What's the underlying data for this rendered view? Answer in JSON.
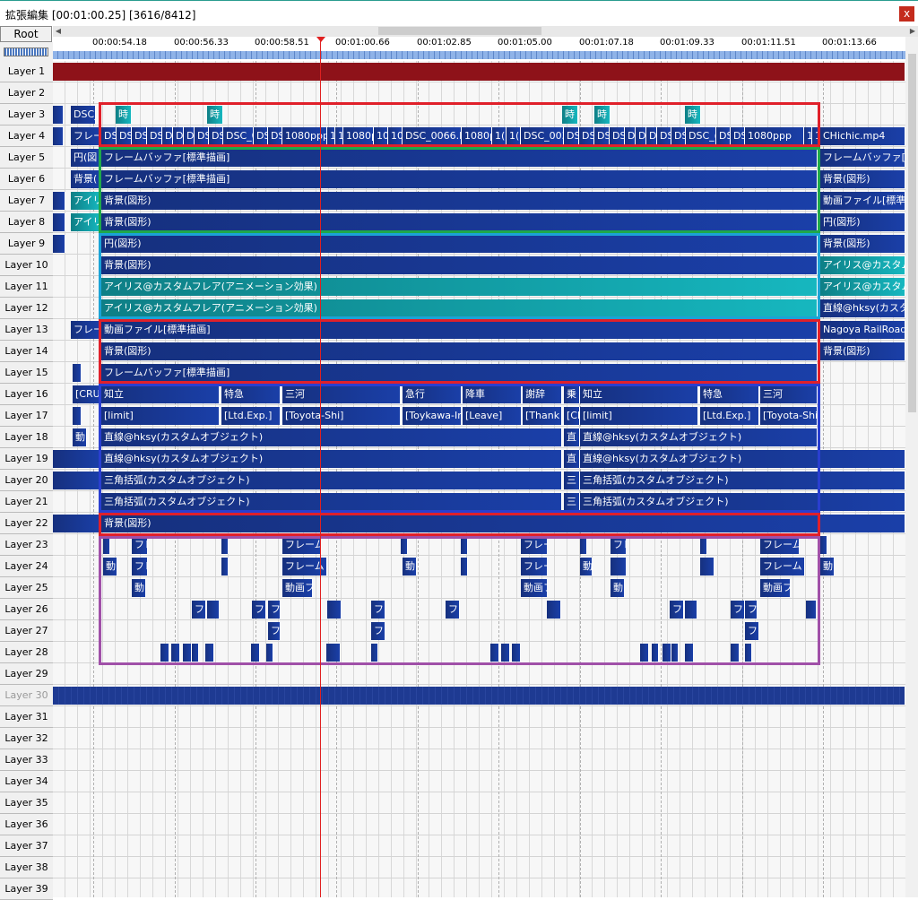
{
  "window": {
    "title": "拡張編集 [00:01:00.25] [3616/8412]",
    "close_label": "x"
  },
  "root_button": "Root",
  "ruler": {
    "ticks": [
      "00:00:54.18",
      "00:00:56.33",
      "00:00:58.51",
      "00:01:00.66",
      "00:01:02.85",
      "00:01:05.00",
      "00:01:07.18",
      "00:01:09.33",
      "00:01:11.51",
      "00:01:13.66"
    ]
  },
  "layers": [
    "Layer 1",
    "Layer 2",
    "Layer 3",
    "Layer 4",
    "Layer 5",
    "Layer 6",
    "Layer 7",
    "Layer 8",
    "Layer 9",
    "Layer 10",
    "Layer 11",
    "Layer 12",
    "Layer 13",
    "Layer 14",
    "Layer 15",
    "Layer 16",
    "Layer 17",
    "Layer 18",
    "Layer 19",
    "Layer 20",
    "Layer 21",
    "Layer 22",
    "Layer 23",
    "Layer 24",
    "Layer 25",
    "Layer 26",
    "Layer 27",
    "Layer 28",
    "Layer 29",
    "Layer 30",
    "Layer 31",
    "Layer 32",
    "Layer 33",
    "Layer 34",
    "Layer 35",
    "Layer 36",
    "Layer 37",
    "Layer 38",
    "Layer 39"
  ],
  "colors": {
    "clip_blue": "#1a3fa8",
    "clip_teal": "#16b7bf",
    "clip_maroon": "#8e1219",
    "cursor": "#e02020",
    "highlight_red": "#e0202a",
    "highlight_green": "#1fa84a",
    "highlight_cyan": "#1ba3d6",
    "highlight_blue": "#2a3fd0",
    "highlight_purple": "#a050a8"
  },
  "clips": {
    "l3": [
      "DSC_(",
      "時",
      "時",
      "時",
      "時",
      "時"
    ],
    "l4": [
      "フレー",
      "DS",
      "DS",
      "DS",
      "DS",
      "D",
      "D",
      "D",
      "DS",
      "DS",
      "DSC_0",
      "DS",
      "DS",
      "1080ppp",
      "1",
      "1",
      "1080p",
      "10",
      "10",
      "DSC_0066.M(",
      "1080p",
      "1(",
      "1(",
      "DSC_003(",
      "DS",
      "DS",
      "DS",
      "DS",
      "D",
      "D",
      "D",
      "DS",
      "DS",
      "DSC_(",
      "DS",
      "DS",
      "1080ppp",
      "1",
      "1",
      "CHichic.mp4"
    ],
    "l5": [
      "円(図",
      "フレームバッファ[標準描画]",
      "フレームバッファ[標準描"
    ],
    "l6": [
      "背景(",
      "フレームバッファ[標準描画]",
      "背景(図形)"
    ],
    "l7": [
      "アイリ",
      "背景(図形)",
      "動画ファイル[標準描画"
    ],
    "l8": [
      "アイリ",
      "背景(図形)",
      "円(図形)"
    ],
    "l9": [
      "円(図形)",
      "背景(図形)"
    ],
    "l10": [
      "背景(図形)",
      "アイリス@カスタムフレ"
    ],
    "l11": [
      "アイリス@カスタムフレア(アニメーション効果)",
      "アイリス@カスタムフレ"
    ],
    "l12": [
      "アイリス@カスタムフレア(アニメーション効果)",
      "直線@hksy(カスタム"
    ],
    "l13": [
      "フレー",
      "動画ファイル[標準描画]",
      "Nagoya RailRoad ×"
    ],
    "l14": [
      "背景(図形)",
      "背景(図形)"
    ],
    "l15": [
      "フレームバッファ[標準描画]"
    ],
    "l16": [
      "[CRUS",
      "知立",
      "特急",
      "三河",
      "急行",
      "降車",
      "謝辞",
      "乗",
      "知立",
      "特急",
      "三河"
    ],
    "l17": [
      "[limit]",
      "[Ltd.Exp.]",
      "[Toyota-Shi]",
      "[Toykawa-Ina",
      "[Leave]",
      "[Thank y",
      "[Cl",
      "[limit]",
      "[Ltd.Exp.]",
      "[Toyota-Shi]"
    ],
    "l18": [
      "動",
      "直線@hksy(カスタムオブジェクト)",
      "直",
      "直線@hksy(カスタムオブジェクト)"
    ],
    "l19": [
      "直線@hksy(カスタムオブジェクト)",
      "直",
      "直線@hksy(カスタムオブジェクト)"
    ],
    "l20": [
      "三角括弧(カスタムオブジェクト)",
      "三",
      "三角括弧(カスタムオブジェクト)"
    ],
    "l21": [
      "三角括弧(カスタムオブジェクト)",
      "三",
      "三角括弧(カスタムオブジェクト)"
    ],
    "l22": [
      "背景(図形)"
    ],
    "l23": [
      "フレ",
      "フレーム",
      "フレー",
      "フレ",
      "フレーム"
    ],
    "l24": [
      "動",
      "フレ",
      "フレーム",
      "動",
      "フレー",
      "動",
      "フレーム",
      "動"
    ],
    "l25": [
      "動",
      "動画フ",
      "動画フ",
      "動",
      "動画フ"
    ],
    "l26": [
      "フレ",
      "フレ",
      "フレ",
      "フレ",
      "フレ",
      "フレ",
      "フレ",
      "フレ"
    ],
    "l27": [
      "フレ",
      "フレ",
      "フレ"
    ]
  }
}
